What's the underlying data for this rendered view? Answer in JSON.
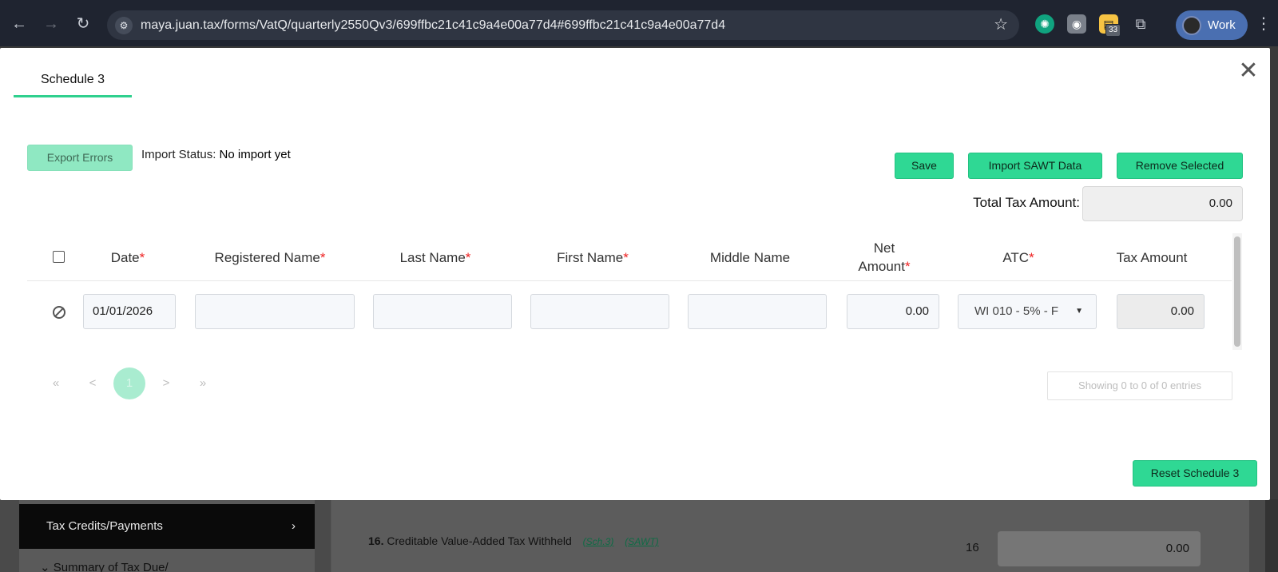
{
  "browser": {
    "url": "maya.juan.tax/forms/VatQ/quarterly2550Qv3/699ffbc21c41c9a4e00a77d4#699ffbc21c41c9a4e00a77d4",
    "extension_badge": "33",
    "profile_name": "Work"
  },
  "modal": {
    "tab_label": "Schedule 3",
    "export_errors_label": "Export Errors",
    "import_status_label": "Import Status:",
    "import_status_value": "No import yet",
    "save_label": "Save",
    "import_sawt_label": "Import SAWT Data",
    "remove_selected_label": "Remove Selected",
    "total_tax_label": "Total Tax Amount:",
    "total_tax_value": "0.00",
    "reset_label": "Reset Schedule 3"
  },
  "table": {
    "columns": [
      {
        "label": "Date",
        "required": "*"
      },
      {
        "label": "Registered Name",
        "required": "*"
      },
      {
        "label": "Last Name",
        "required": "*"
      },
      {
        "label": "First Name",
        "required": "*"
      },
      {
        "label": "Middle Name",
        "required": ""
      },
      {
        "label_line1": "Net",
        "label_line2": "Amount",
        "required": "*"
      },
      {
        "label": "ATC",
        "required": "*"
      },
      {
        "label": "Tax Amount",
        "required": ""
      }
    ],
    "row": {
      "date": "01/01/2026",
      "registered_name": "",
      "last_name": "",
      "first_name": "",
      "middle_name": "",
      "net_amount": "0.00",
      "atc": "WI 010 - 5% - F",
      "tax_amount": "0.00"
    }
  },
  "pagination": {
    "first": "«",
    "prev": "<",
    "current": "1",
    "next": ">",
    "last": "»",
    "showing": "Showing 0 to 0 of 0 entries"
  },
  "background": {
    "sidebar_active": "Tax Credits/Payments",
    "sidebar_next": "Summary of Tax Due/",
    "line16_number": "16.",
    "line16_label": "Creditable Value-Added Tax Withheld",
    "line16_link1": "(Sch.3)",
    "line16_link2": "(SAWT)",
    "line16_code": "16",
    "line16_value": "0.00"
  }
}
